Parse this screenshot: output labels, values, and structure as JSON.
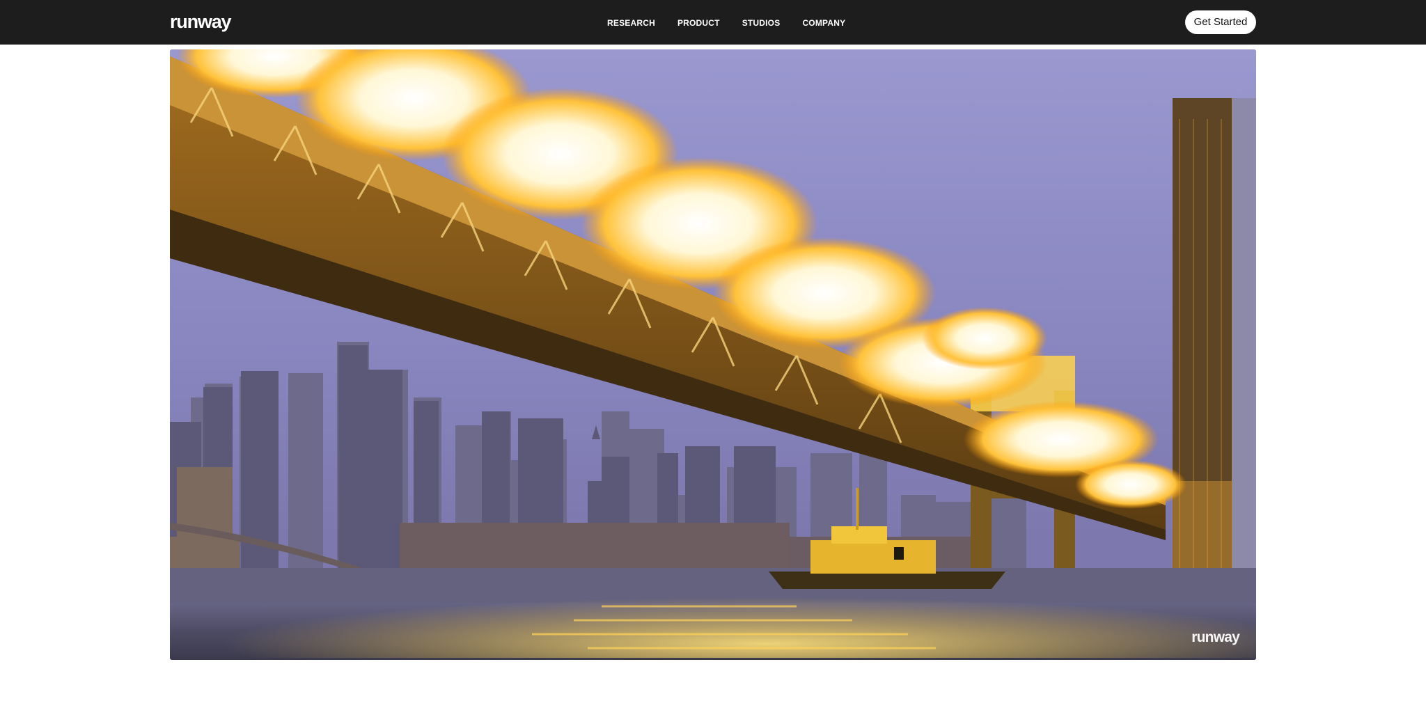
{
  "brand": {
    "logo_text": "runway"
  },
  "nav": {
    "items": [
      {
        "label": "RESEARCH"
      },
      {
        "label": "PRODUCT"
      },
      {
        "label": "STUDIOS"
      },
      {
        "label": "COMPANY"
      }
    ],
    "cta_label": "Get Started"
  },
  "hero": {
    "watermark": "runway"
  },
  "colors": {
    "topbar": "#1d1d1d",
    "sky": "#8b88c2",
    "fire": "#ffb000",
    "water": "#4a4a6a"
  }
}
